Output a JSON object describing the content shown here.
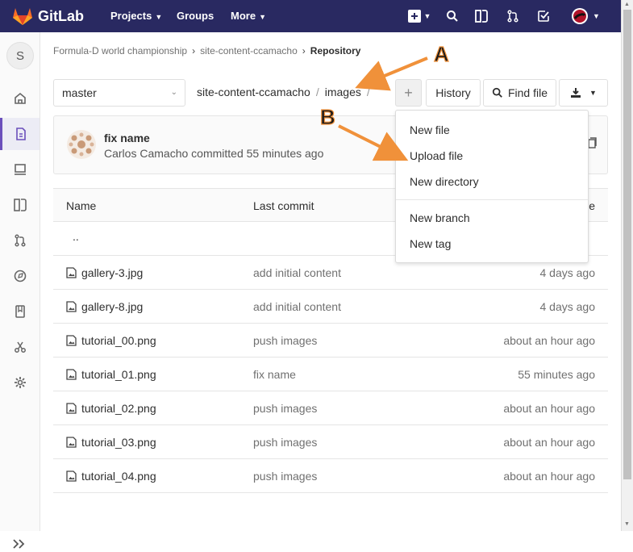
{
  "app": {
    "name": "GitLab"
  },
  "topnav": {
    "projects": "Projects",
    "groups": "Groups",
    "more": "More"
  },
  "sidebar": {
    "avatar_letter": "S"
  },
  "breadcrumb": {
    "group": "Formula-D world championship",
    "project": "site-content-ccamacho",
    "current": "Repository"
  },
  "repo": {
    "branch": "master",
    "path": [
      "site-content-ccamacho",
      "images"
    ],
    "history_label": "History",
    "find_file_label": "Find file"
  },
  "commit": {
    "title": "fix name",
    "author": "Carlos Camacho",
    "action": "committed",
    "time": "55 minutes ago"
  },
  "table": {
    "headers": {
      "name": "Name",
      "last_commit": "Last commit",
      "last_update": "e"
    },
    "parent": "..",
    "rows": [
      {
        "name": "gallery-3.jpg",
        "commit": "add initial content",
        "time": "4 days ago"
      },
      {
        "name": "gallery-8.jpg",
        "commit": "add initial content",
        "time": "4 days ago"
      },
      {
        "name": "tutorial_00.png",
        "commit": "push images",
        "time": "about an hour ago"
      },
      {
        "name": "tutorial_01.png",
        "commit": "fix name",
        "time": "55 minutes ago"
      },
      {
        "name": "tutorial_02.png",
        "commit": "push images",
        "time": "about an hour ago"
      },
      {
        "name": "tutorial_03.png",
        "commit": "push images",
        "time": "about an hour ago"
      },
      {
        "name": "tutorial_04.png",
        "commit": "push images",
        "time": "about an hour ago"
      }
    ]
  },
  "dropdown": {
    "items": [
      "New file",
      "Upload file",
      "New directory"
    ],
    "items2": [
      "New branch",
      "New tag"
    ]
  },
  "annotations": {
    "a": "A",
    "b": "B"
  },
  "colors": {
    "navbar": "#292961",
    "accent": "#6b4fbb",
    "arrow": "#f0913a",
    "logo": "#fc6d26"
  }
}
